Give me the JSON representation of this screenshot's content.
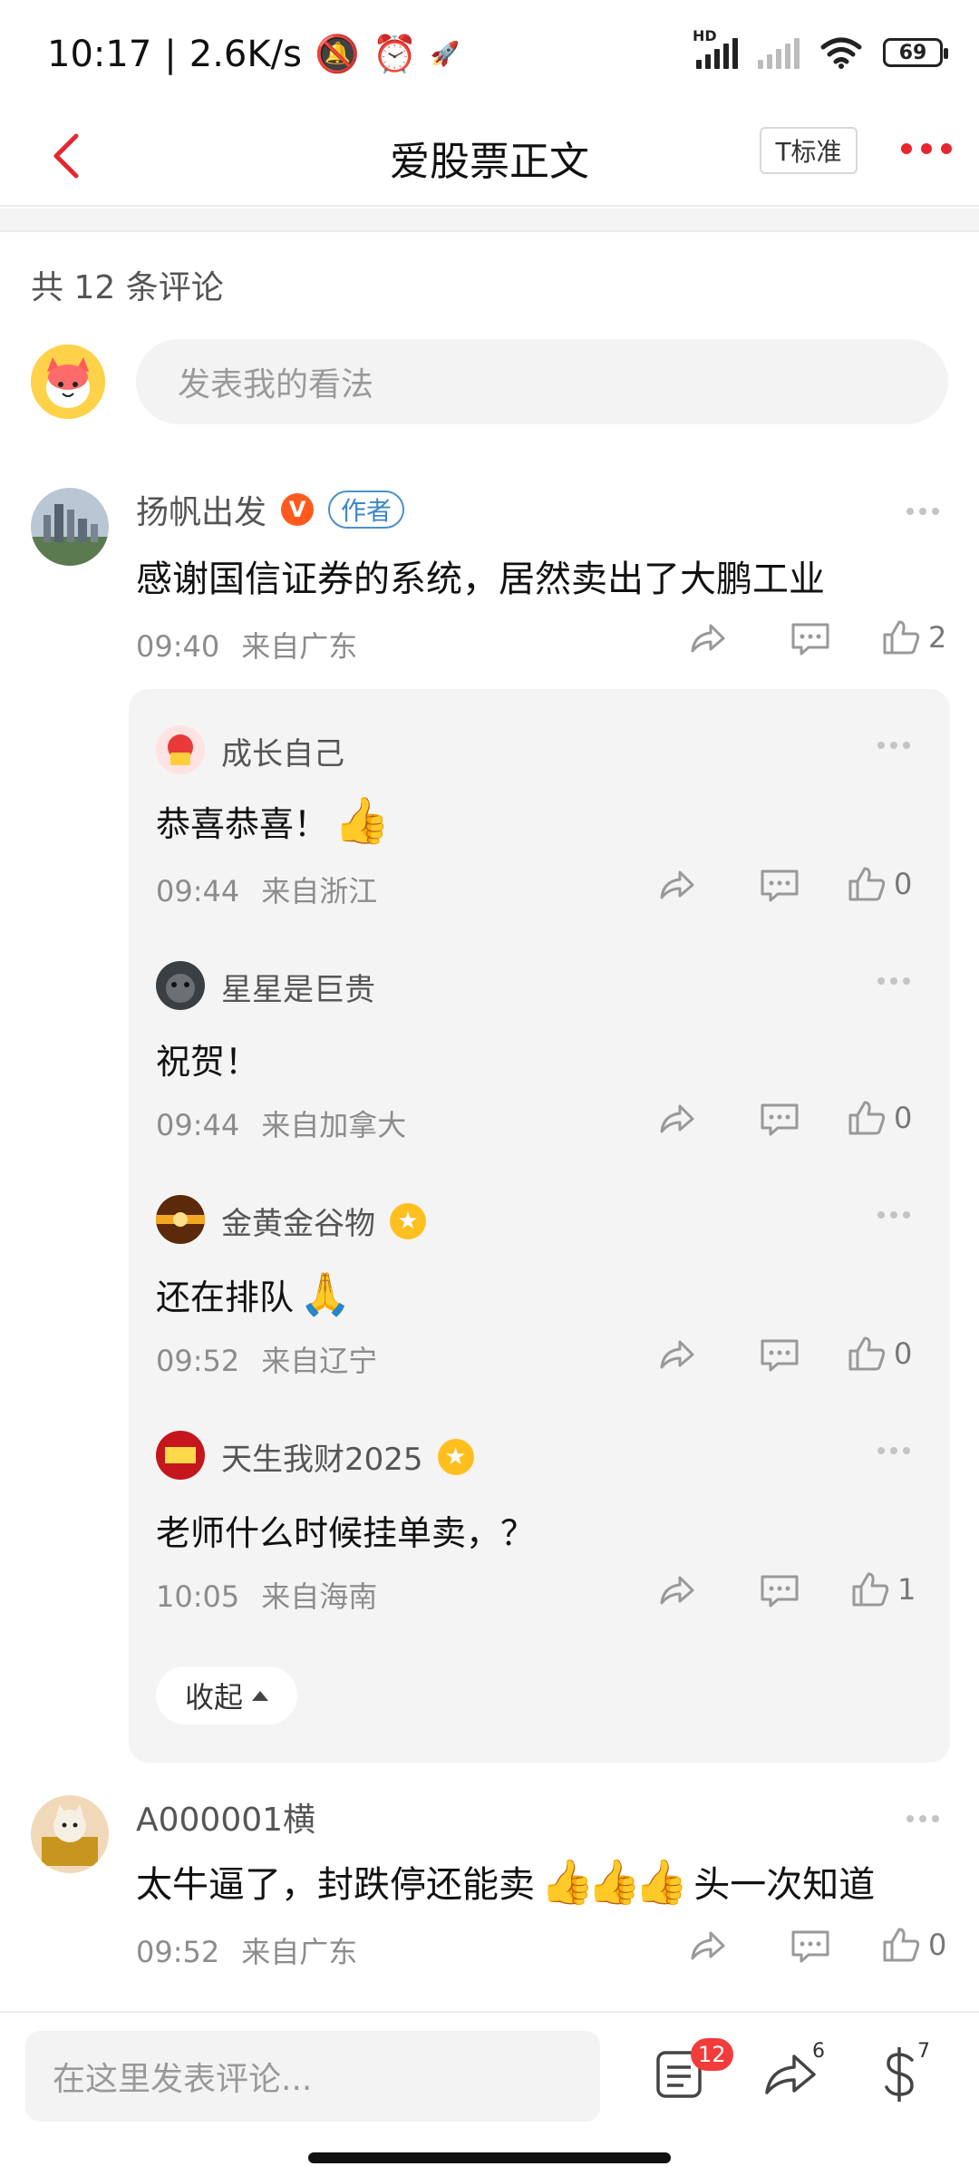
{
  "status_bar": {
    "time": "10:17",
    "speed": "2.6K/s",
    "network_label": "HD",
    "battery": "69"
  },
  "header": {
    "title": "爱股票正文",
    "text_size_label": "T标准"
  },
  "comment_count": "共 12 条评论",
  "top_input": {
    "placeholder": "发表我的看法"
  },
  "comments": [
    {
      "name": "扬帆出发",
      "author_badge": "作者",
      "text": "感谢国信证券的系统，居然卖出了大鹏工业",
      "time": "09:40",
      "location": "来自广东",
      "likes": "2",
      "replies": [
        {
          "name": "成长自己",
          "text": "恭喜恭喜！",
          "time": "09:44",
          "location": "来自浙江",
          "likes": "0"
        },
        {
          "name": "星星是巨贵",
          "text": "祝贺！",
          "time": "09:44",
          "location": "来自加拿大",
          "likes": "0"
        },
        {
          "name": "金黄金谷物",
          "text": "还在排队",
          "time": "09:52",
          "location": "来自辽宁",
          "likes": "0"
        },
        {
          "name": "天生我财2025",
          "text": "老师什么时候挂单卖，？",
          "time": "10:05",
          "location": "来自海南",
          "likes": "1"
        }
      ],
      "collapse_label": "收起"
    },
    {
      "name": "A000001横",
      "text_before": "太牛逼了，封跌停还能卖",
      "text_after": "头一次知道",
      "time": "09:52",
      "location": "来自广东",
      "likes": "0"
    }
  ],
  "bottom_bar": {
    "placeholder": "在这里发表评论...",
    "comment_badge": "12",
    "share_count": "6",
    "reward_count": "7"
  }
}
